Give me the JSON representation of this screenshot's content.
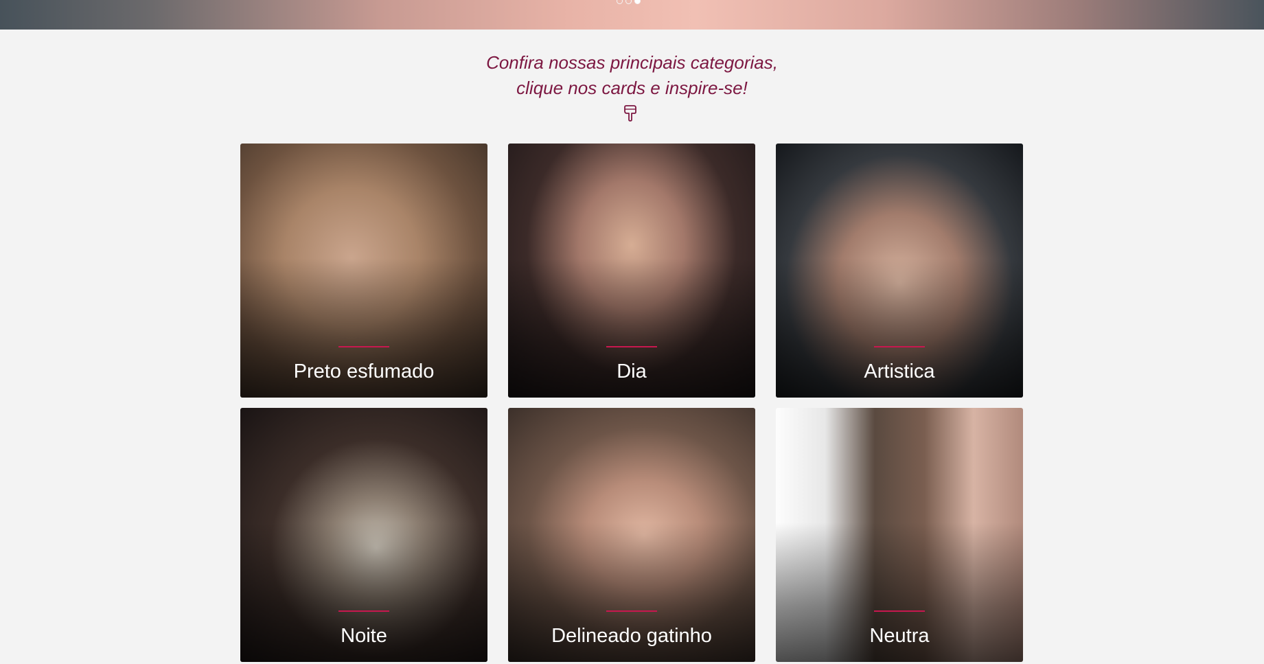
{
  "banner": {
    "slides": [
      {
        "active": false
      },
      {
        "active": false
      },
      {
        "active": true
      }
    ]
  },
  "intro": {
    "line1": "Confira nossas principais categorias,",
    "line2": "clique nos cards e inspire-se!",
    "icon": "pointing-down-hand-icon"
  },
  "colors": {
    "accent": "#7c1741",
    "rule": "#c8174f",
    "background": "#f3f3f3"
  },
  "cards": [
    {
      "label": "Preto esfumado"
    },
    {
      "label": "Dia"
    },
    {
      "label": "Artistica"
    },
    {
      "label": "Noite"
    },
    {
      "label": "Delineado gatinho"
    },
    {
      "label": "Neutra"
    }
  ]
}
